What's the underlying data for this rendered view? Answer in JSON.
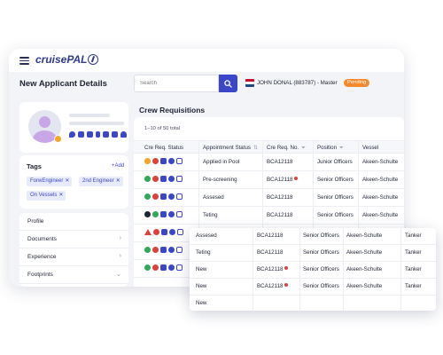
{
  "app": {
    "brand": "cruisePAL"
  },
  "header": {
    "page_title": "New Applicant Details",
    "search_placeholder": "Search",
    "user": "JOHN DONAL (883787) - Master",
    "status": "Pending"
  },
  "tags": {
    "title": "Tags",
    "add_label": "+Add",
    "items": [
      "ForwEngineer",
      "2nd Engineer",
      "On Vessels"
    ]
  },
  "menu": {
    "items": [
      "Profile",
      "Documents",
      "Experience",
      "Footprints"
    ]
  },
  "crew": {
    "title": "Crew Requisitions",
    "count": "1–10 of 50 total",
    "columns": [
      "Cre Req. Status",
      "Appointment Status",
      "Cre Req. No.",
      "Position",
      "Vessel"
    ],
    "rows": [
      {
        "appointment": "Applied in Pool",
        "req_no": "BCA12118",
        "position": "Junior Officers",
        "vessel": "Akeen-Schulte"
      },
      {
        "appointment": "Pre-screening",
        "req_no": "BCA12118",
        "position": "Senior Officers",
        "vessel": "Akeen-Schulte"
      },
      {
        "appointment": "Assesed",
        "req_no": "BCA12118",
        "position": "Senior Officers",
        "vessel": "Akeen-Schulte"
      },
      {
        "appointment": "Teting",
        "req_no": "BCA12118",
        "position": "Senior Officers",
        "vessel": "Akeen-Schulte"
      },
      {
        "appointment": "",
        "req_no": "",
        "position": "",
        "vessel": ""
      },
      {
        "appointment": "",
        "req_no": "",
        "position": "",
        "vessel": ""
      },
      {
        "appointment": "",
        "req_no": "",
        "position": "",
        "vessel": ""
      }
    ]
  },
  "overlay": {
    "rows": [
      {
        "appointment": "Assesed",
        "req_no": "BCA12118",
        "position": "Senior Officers",
        "vessel": "Akeen-Schulte",
        "type": "Tanker"
      },
      {
        "appointment": "Teting",
        "req_no": "BCA12118",
        "position": "Senior Officers",
        "vessel": "Akeen-Schulte",
        "type": "Tanker"
      },
      {
        "appointment": "New",
        "req_no": "BCA12118",
        "position": "Senior Officers",
        "vessel": "Akeen-Schulte",
        "type": "Tanker"
      },
      {
        "appointment": "New",
        "req_no": "BCA12118",
        "position": "Senior Officers",
        "vessel": "Akeen-Schulte",
        "type": "Tanker"
      },
      {
        "appointment": "New",
        "req_no": "",
        "position": "",
        "vessel": "",
        "type": ""
      }
    ]
  },
  "colors": {
    "primary": "#3b47c8",
    "status_pending": "#f58a2d",
    "danger": "#e0403a",
    "success": "#2eaa5a"
  }
}
